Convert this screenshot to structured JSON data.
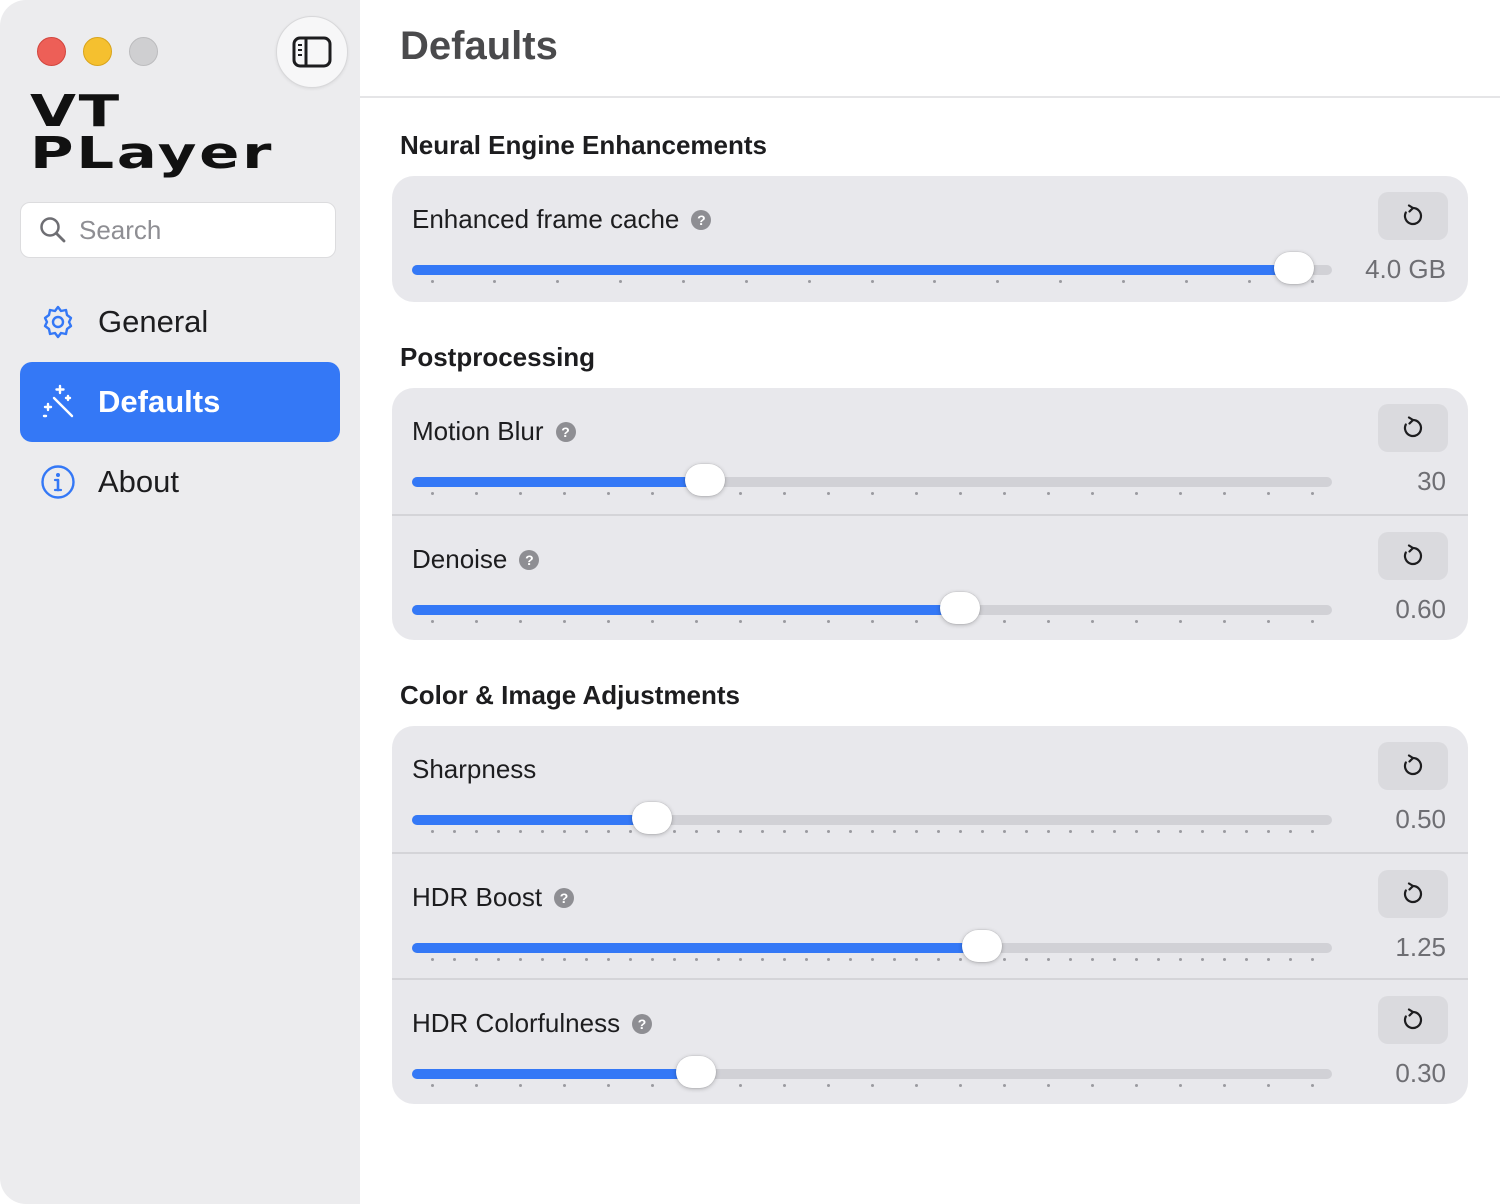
{
  "sidebar": {
    "brand_line1": "VT",
    "brand_line2": "PLayer",
    "search_placeholder": "Search",
    "items": [
      {
        "label": "General",
        "icon": "gear-icon"
      },
      {
        "label": "Defaults",
        "icon": "magic-wand-icon",
        "active": true
      },
      {
        "label": "About",
        "icon": "info-icon"
      }
    ]
  },
  "main": {
    "title": "Defaults",
    "sections": [
      {
        "title": "Neural Engine Enhancements",
        "rows": [
          {
            "label": "Enhanced frame cache",
            "help": true,
            "value": "4.0 GB",
            "fraction": 0.98,
            "ticks": 15
          }
        ]
      },
      {
        "title": "Postprocessing",
        "rows": [
          {
            "label": "Motion Blur",
            "help": true,
            "value": "30",
            "fraction": 0.31,
            "ticks": 21
          },
          {
            "label": "Denoise",
            "help": true,
            "value": "0.60",
            "fraction": 0.6,
            "ticks": 21
          }
        ]
      },
      {
        "title": "Color & Image Adjustments",
        "rows": [
          {
            "label": "Sharpness",
            "help": false,
            "value": "0.50",
            "fraction": 0.25,
            "ticks": 41
          },
          {
            "label": "HDR Boost",
            "help": true,
            "value": "1.25",
            "fraction": 0.625,
            "ticks": 41
          },
          {
            "label": "HDR Colorfulness",
            "help": true,
            "value": "0.30",
            "fraction": 0.3,
            "ticks": 21
          }
        ]
      }
    ]
  },
  "colors": {
    "accent": "#3478f6",
    "sidebar_bg": "#ececee",
    "card_bg": "#e8e8ec",
    "track": "#d1d1d6"
  }
}
